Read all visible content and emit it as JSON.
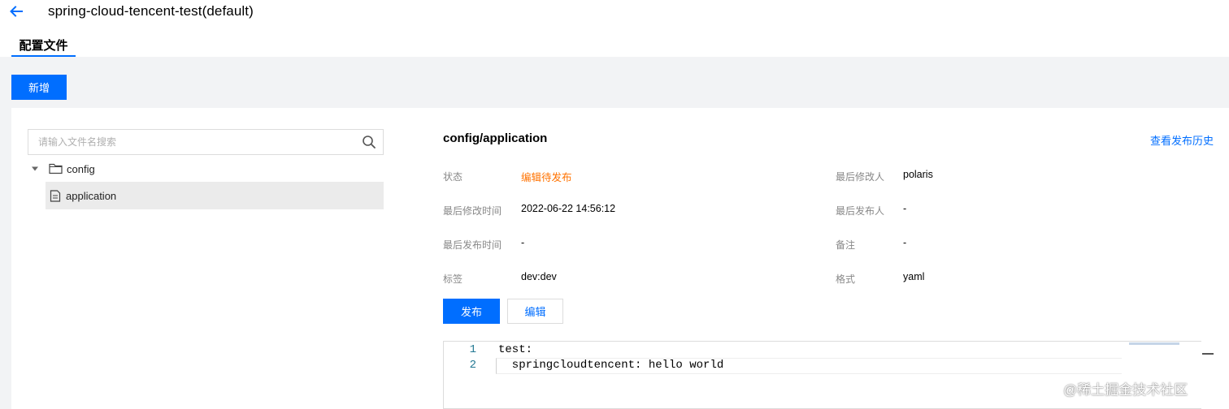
{
  "header": {
    "title": "spring-cloud-tencent-test(default)",
    "back_icon": "arrow-left-icon"
  },
  "tabs": [
    {
      "label": "配置文件",
      "active": true
    }
  ],
  "toolbar": {
    "add_label": "新增"
  },
  "file_tree": {
    "search_placeholder": "请输入文件名搜索",
    "folders": [
      {
        "name": "config",
        "expanded": true,
        "files": [
          {
            "name": "application",
            "selected": true
          }
        ]
      }
    ]
  },
  "detail": {
    "title": "config/application",
    "history_link": "查看发布历史",
    "fields": {
      "status_label": "状态",
      "status_value": "编辑待发布",
      "modifier_label": "最后修改人",
      "modifier_value": "polaris",
      "modified_time_label": "最后修改时间",
      "modified_time_value": "2022-06-22 14:56:12",
      "publisher_label": "最后发布人",
      "publisher_value": "-",
      "published_time_label": "最后发布时间",
      "published_time_value": "-",
      "remark_label": "备注",
      "remark_value": "-",
      "tags_label": "标签",
      "tags_value": "dev:dev",
      "format_label": "格式",
      "format_value": "yaml"
    },
    "publish_label": "发布",
    "edit_label": "编辑"
  },
  "editor": {
    "lines": [
      {
        "num": "1",
        "text": "test:"
      },
      {
        "num": "2",
        "text": "  springcloudtencent: hello world"
      }
    ]
  },
  "watermark": "@稀土掘金技术社区",
  "colors": {
    "primary": "#006eff",
    "status_pending": "#ff7200",
    "page_bg": "#f2f3f5",
    "line_number": "#237893"
  }
}
